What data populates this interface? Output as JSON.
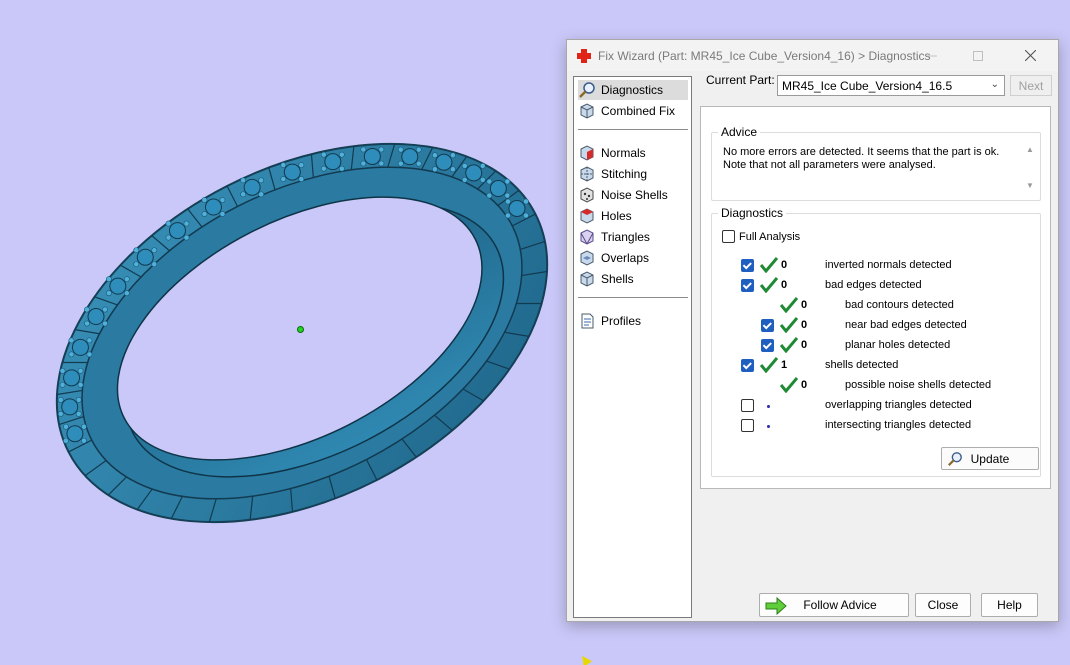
{
  "dialog": {
    "title": "Fix Wizard (Part: MR45_Ice Cube_Version4_16) > Diagnostics"
  },
  "nav": {
    "items": [
      {
        "label": "Diagnostics",
        "icon": "magnifier-icon"
      },
      {
        "label": "Combined Fix",
        "icon": "cube-icon"
      },
      {
        "label": "Normals",
        "icon": "normals-icon"
      },
      {
        "label": "Stitching",
        "icon": "stitching-icon"
      },
      {
        "label": "Noise Shells",
        "icon": "noise-shells-icon"
      },
      {
        "label": "Holes",
        "icon": "holes-icon"
      },
      {
        "label": "Triangles",
        "icon": "triangles-icon"
      },
      {
        "label": "Overlaps",
        "icon": "overlaps-icon"
      },
      {
        "label": "Shells",
        "icon": "shells-icon"
      },
      {
        "label": "Profiles",
        "icon": "profiles-icon"
      }
    ]
  },
  "current_part": {
    "label": "Current Part:",
    "value": "MR45_Ice Cube_Version4_16.5",
    "next_label": "Next"
  },
  "advice": {
    "title": "Advice",
    "text": "No more errors are detected. It seems that the part is ok. Note that not all parameters were analysed."
  },
  "diagnostics": {
    "title": "Diagnostics",
    "full_analysis_label": "Full Analysis",
    "full_analysis_checked": false,
    "rows": [
      {
        "checked": true,
        "has_checkbox": true,
        "status": "ok",
        "count": "0",
        "label": "inverted normals detected",
        "indent": 0
      },
      {
        "checked": true,
        "has_checkbox": true,
        "status": "ok",
        "count": "0",
        "label": "bad edges detected",
        "indent": 0
      },
      {
        "checked": false,
        "has_checkbox": false,
        "status": "ok",
        "count": "0",
        "label": "bad contours detected",
        "indent": 1
      },
      {
        "checked": true,
        "has_checkbox": true,
        "status": "ok",
        "count": "0",
        "label": "near bad edges detected",
        "indent": 1
      },
      {
        "checked": true,
        "has_checkbox": true,
        "status": "ok",
        "count": "0",
        "label": "planar holes detected",
        "indent": 1
      },
      {
        "checked": true,
        "has_checkbox": true,
        "status": "ok",
        "count": "1",
        "label": "shells detected",
        "indent": 0
      },
      {
        "checked": false,
        "has_checkbox": false,
        "status": "ok",
        "count": "0",
        "label": "possible noise shells detected",
        "indent": 1
      },
      {
        "checked": false,
        "has_checkbox": true,
        "status": "none",
        "count": "",
        "label": "overlapping triangles detected",
        "indent": 0
      },
      {
        "checked": false,
        "has_checkbox": true,
        "status": "none",
        "count": "",
        "label": "intersecting triangles detected",
        "indent": 0
      }
    ],
    "update_label": "Update"
  },
  "footer": {
    "follow_advice_label": "Follow Advice",
    "close_label": "Close",
    "help_label": "Help"
  },
  "colors": {
    "viewport_bg": "#cac8f8",
    "ring": "#2c7fa6",
    "ring_dark": "#1b5878",
    "tick_green": "#1f8a33",
    "checkbox_blue": "#1e5fbf"
  }
}
